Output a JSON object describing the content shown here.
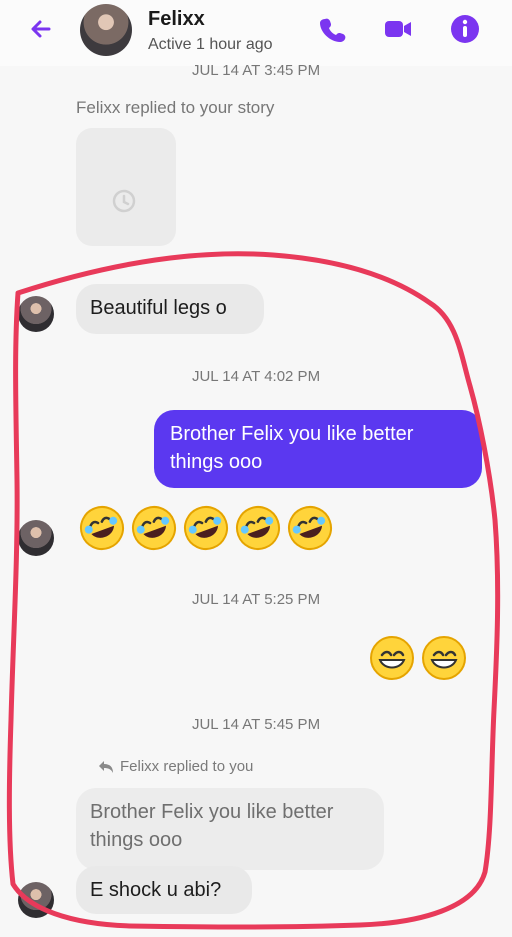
{
  "header": {
    "title": "Felixx",
    "subtitle": "Active 1 hour ago"
  },
  "conversation": {
    "timestamp_1": "JUL 14 AT 3:45 PM",
    "story_reply_note": "Felixx replied to your story",
    "msg_1": "Beautiful legs o",
    "timestamp_2": "JUL 14 AT 4:02 PM",
    "msg_2_line_1": "Brother Felix you like better",
    "msg_2_line_2": "things ooo",
    "timestamp_3": "JUL 14 AT 5:25 PM",
    "timestamp_4": "JUL 14 AT 5:45 PM",
    "replied_to_you": "Felixx replied to you",
    "quoted_line_1": "Brother Felix you like better",
    "quoted_line_2": "things ooo",
    "msg_last": "E shock u abi?"
  },
  "colors": {
    "accent": "#7b35f0",
    "outgoing_bubble": "#5b38f0",
    "annotation_red": "#e83a5a"
  },
  "icons": {
    "back": "arrow-left-icon",
    "call": "phone-icon",
    "video": "video-icon",
    "info": "info-icon",
    "story": "history-icon",
    "reply": "reply-arrow-icon",
    "laughing": "rolling-laughing-face-icon",
    "smiling": "grinning-face-icon"
  }
}
